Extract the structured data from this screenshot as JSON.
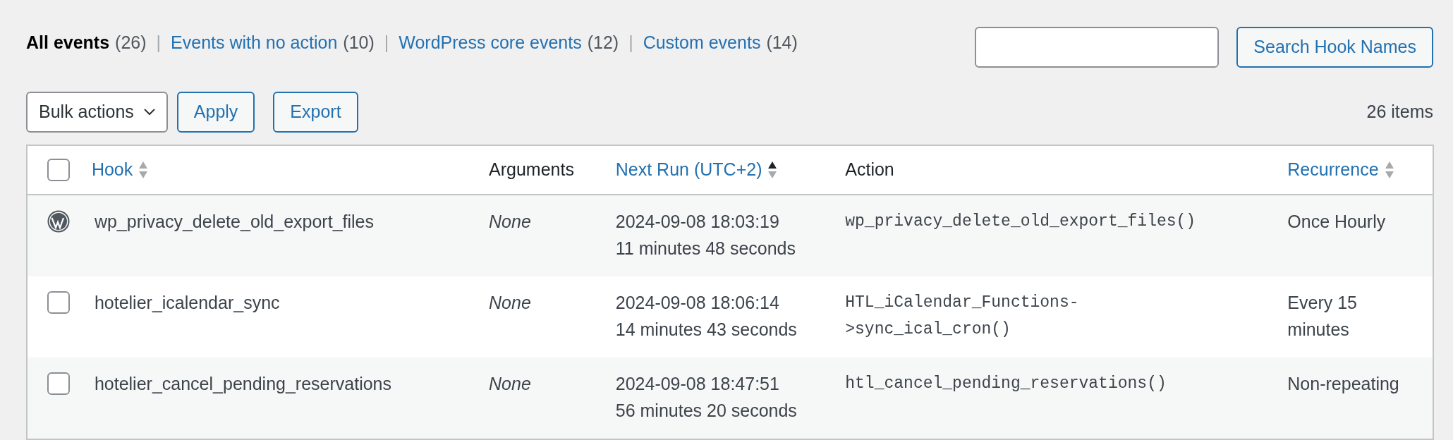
{
  "filters": [
    {
      "label": "All events",
      "count": "(26)",
      "selected": true
    },
    {
      "label": "Events with no action",
      "count": "(10)",
      "selected": false
    },
    {
      "label": "WordPress core events",
      "count": "(12)",
      "selected": false
    },
    {
      "label": "Custom events",
      "count": "(14)",
      "selected": false
    }
  ],
  "filter_separator": "|",
  "search": {
    "button": "Search Hook Names"
  },
  "toolbar": {
    "bulk_actions": "Bulk actions",
    "apply": "Apply",
    "export": "Export",
    "item_count": "26 items"
  },
  "table": {
    "select_all": {
      "checked": false
    },
    "columns": [
      {
        "kind": "sortable",
        "label": "Hook",
        "sorted": false
      },
      {
        "kind": "plain",
        "label": "Arguments"
      },
      {
        "kind": "sortable",
        "label": "Next Run (UTC+2)",
        "sorted": true
      },
      {
        "kind": "plain",
        "label": "Action"
      },
      {
        "kind": "sortable",
        "label": "Recurrence",
        "sorted": false
      }
    ],
    "rows": [
      {
        "kind": "core",
        "hook": "wp_privacy_delete_old_export_files",
        "arguments": "None",
        "next_run": "2024-09-08 18:03:19",
        "time_left": "11 minutes 48 seconds",
        "action": "wp_privacy_delete_old_export_files()",
        "recurrence": "Once Hourly"
      },
      {
        "kind": "custom",
        "checked": false,
        "hook": "hotelier_icalendar_sync",
        "arguments": "None",
        "next_run": "2024-09-08 18:06:14",
        "time_left": "14 minutes 43 seconds",
        "action": "HTL_iCalendar_Functions->sync_ical_cron()",
        "recurrence": "Every 15 minutes"
      },
      {
        "kind": "custom",
        "checked": false,
        "hook": "hotelier_cancel_pending_reservations",
        "arguments": "None",
        "next_run": "2024-09-08 18:47:51",
        "time_left": "56 minutes 20 seconds",
        "action": "htl_cancel_pending_reservations()",
        "recurrence": "Non-repeating"
      }
    ]
  }
}
